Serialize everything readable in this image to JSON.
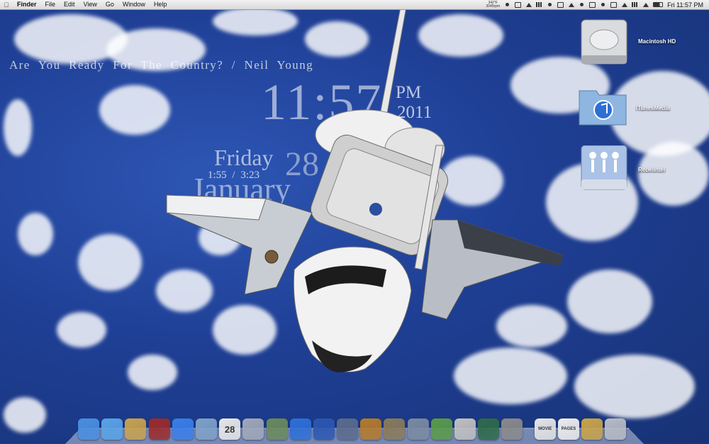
{
  "menubar": {
    "apple_icon": "apple-logo-icon",
    "items": [
      "Finder",
      "File",
      "Edit",
      "View",
      "Go",
      "Window",
      "Help"
    ],
    "cpu_lines": [
      "342°F",
      "3045rpm"
    ],
    "clock": "Fri 11:57 PM"
  },
  "widgets": {
    "song": "Are You Ready For The Country?  /  Neil Young",
    "time": "11:57",
    "ampm": "PM",
    "year": "2011",
    "weekday": "Friday",
    "day": "28",
    "track_progress": "1:55  /  3:23",
    "month": "January"
  },
  "desktop_icons": [
    {
      "label": "Macintosh HD",
      "icon": "hard-drive-icon"
    },
    {
      "label": "iTunesMedia",
      "icon": "itunes-folder-icon"
    },
    {
      "label": "RebelIntel",
      "icon": "shared-drive-icon"
    }
  ],
  "dock": [
    {
      "name": "finder",
      "icon": "finder-icon",
      "color": "#4a8fe0"
    },
    {
      "name": "safari",
      "icon": "safari-icon",
      "color": "#5aa3e6"
    },
    {
      "name": "address-book",
      "icon": "address-book-icon",
      "color": "#c9a24d"
    },
    {
      "name": "dictionary",
      "icon": "dictionary-icon",
      "color": "#9b2b2b"
    },
    {
      "name": "ichat",
      "icon": "ichat-icon",
      "color": "#3a7ee8"
    },
    {
      "name": "mail",
      "icon": "mail-icon",
      "color": "#7fa1c7"
    },
    {
      "name": "ical",
      "icon": "calendar-icon",
      "color": "#e9e9e9",
      "text": "28"
    },
    {
      "name": "preview",
      "icon": "preview-icon",
      "color": "#a0a8b8"
    },
    {
      "name": "iphoto",
      "icon": "iphoto-icon",
      "color": "#6a8a5a"
    },
    {
      "name": "itunes",
      "icon": "itunes-icon",
      "color": "#2e6fd6"
    },
    {
      "name": "dvd-player",
      "icon": "dvd-player-icon",
      "color": "#2c57b0"
    },
    {
      "name": "imovie",
      "icon": "imovie-icon",
      "color": "#5a6b8c"
    },
    {
      "name": "garageband",
      "icon": "garageband-icon",
      "color": "#b57a2b"
    },
    {
      "name": "keynote",
      "icon": "keynote-icon",
      "color": "#8a7a5a"
    },
    {
      "name": "directory-utility",
      "icon": "directory-utility-icon",
      "color": "#7a8aa0"
    },
    {
      "name": "numbers",
      "icon": "numbers-icon",
      "color": "#5a9a4a"
    },
    {
      "name": "text-edit",
      "icon": "text-edit-icon",
      "color": "#c0c0c0"
    },
    {
      "name": "time-machine",
      "icon": "time-machine-icon",
      "color": "#2f6a4a"
    },
    {
      "name": "system-preferences",
      "icon": "system-preferences-icon",
      "color": "#8a8a8a"
    },
    {
      "name": "sep",
      "icon": "",
      "color": ""
    },
    {
      "name": "movie-doc",
      "icon": "movie-document-icon",
      "color": "#e6e6e6",
      "text": "MOVIE"
    },
    {
      "name": "pages-doc",
      "icon": "pages-document-icon",
      "color": "#eeeeee",
      "text": "PAGES"
    },
    {
      "name": "applications-stack",
      "icon": "applications-folder-icon",
      "color": "#c9a44a"
    },
    {
      "name": "trash",
      "icon": "trash-icon",
      "color": "#b8bcc4"
    }
  ]
}
